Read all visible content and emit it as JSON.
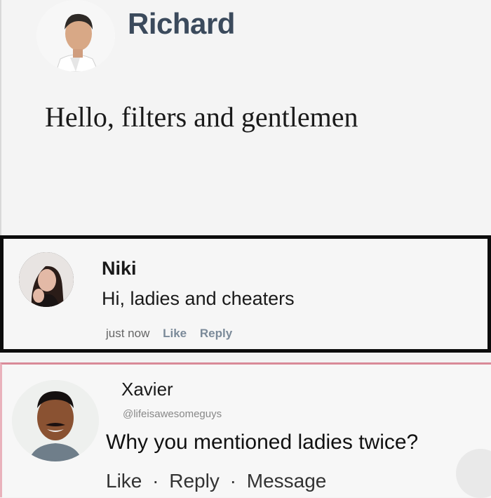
{
  "post": {
    "author": "Richard",
    "text": "Hello, filters and gentlemen"
  },
  "comments": [
    {
      "author": "Niki",
      "text": "Hi, ladies and cheaters",
      "time": "just now",
      "actions": [
        "Like",
        "Reply"
      ]
    },
    {
      "author": "Xavier",
      "handle": "@lifeisawesomeguys",
      "text": "Why you mentioned ladies twice?",
      "actions": [
        "Like",
        "Reply",
        "Message"
      ],
      "separator": "·"
    }
  ],
  "colors": {
    "post_name": "#3b4a5c",
    "highlight_border": "#0c0c0c",
    "second_border": "#d98a98"
  }
}
